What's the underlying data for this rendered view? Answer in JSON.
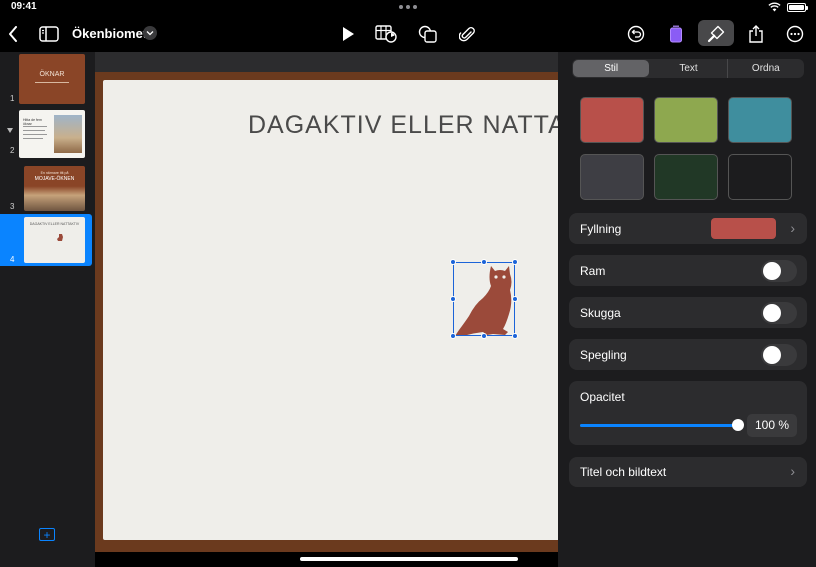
{
  "status_bar": {
    "time": "09:41",
    "battery_level": 1.0
  },
  "toolbar": {
    "back": "back",
    "document_title": "Ökenbiomet",
    "icons": [
      "sidebar-icon",
      "play-icon",
      "table-chart-icon",
      "shapes-icon",
      "attachment-icon",
      "undo-icon",
      "document-icon",
      "paintbrush-icon",
      "share-icon",
      "more-icon"
    ]
  },
  "navigator": {
    "slides": [
      {
        "number": "1",
        "title": "ÖKNAR",
        "selected": false
      },
      {
        "number": "2",
        "title": "Hitta de fem öknar",
        "selected": false
      },
      {
        "number": "3",
        "title": "MOJAVE-ÖKNEN",
        "subtitle": "En närmare titt på",
        "selected": false
      },
      {
        "number": "4",
        "title": "DAGAKTIV ELLER NATTAKTIV",
        "selected": true
      }
    ]
  },
  "slide": {
    "title": "DAGAKTIV ELLER NATTAKTIV"
  },
  "inspector": {
    "tabs": [
      {
        "label": "Stil",
        "active": true
      },
      {
        "label": "Text",
        "active": false
      },
      {
        "label": "Ordna",
        "active": false
      }
    ],
    "style_swatches": [
      "#b8504a",
      "#8ea84f",
      "#3f8e9e",
      "#3e3e44",
      "#213826",
      "#1c1c1e"
    ],
    "fill": {
      "label": "Fyllning",
      "color": "#b8504a"
    },
    "border": {
      "label": "Ram",
      "on": false
    },
    "shadow": {
      "label": "Skugga",
      "on": false
    },
    "reflection": {
      "label": "Spegling",
      "on": false
    },
    "opacity": {
      "label": "Opacitet",
      "value": "100 %",
      "level": 1.0
    },
    "caption": {
      "label": "Titel och bildtext"
    }
  },
  "colors": {
    "accent": "#0a84ff",
    "slide_frame": "#6b3a1e",
    "owl": "#9b4a3a"
  }
}
